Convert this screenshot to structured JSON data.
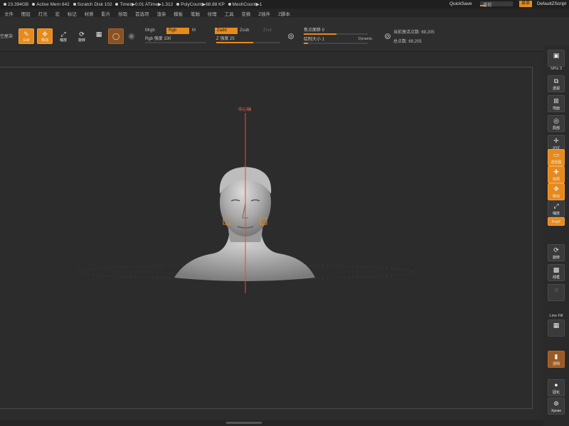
{
  "status_bar": {
    "items": [
      "23.394GB",
      "Active Mem 642",
      "Scratch Disk 102",
      "Timer▶0.01 ATime▶1.312",
      "PolyCount▶68.88 KP",
      "MeshCount▶1"
    ],
    "quicksave": "QuickSave",
    "transparency": "透视",
    "menus_button": "菜单",
    "zscript": "DefaultZScript"
  },
  "menu_bar": {
    "items": [
      "文件",
      "图层",
      "灯光",
      "宏",
      "标记",
      "材质",
      "影片",
      "拾取",
      "首选项",
      "渲染",
      "模板",
      "笔触",
      "纹理",
      "工具",
      "变换",
      "Z插件",
      "Z脚本"
    ]
  },
  "shelf": {
    "left_label": "空屋染",
    "buttons": [
      {
        "icon": "edit-icon",
        "label": "Edit",
        "active": true
      },
      {
        "icon": "move-icon",
        "label": "移动",
        "active": true
      },
      {
        "icon": "scale-icon",
        "label": "缩放",
        "active": false
      },
      {
        "icon": "rotate-icon",
        "label": "旋转",
        "active": false
      },
      {
        "icon": "sphere-icon",
        "label": "",
        "active": true
      }
    ],
    "mrgb": "Mrgb",
    "rgb": "Rgb",
    "m": "M",
    "rgb_intensity": "Rgb 强度 100",
    "zadd": "Zadd",
    "zsub": "Zsub",
    "zcut": "Zcut",
    "z_intensity": "Z 强度 25",
    "focal_shift": "焦点面移 0",
    "draw_size": "绘制大小 1",
    "dynamic": "Dynamic",
    "active_points": "当前激活点数: 69,205",
    "total_points": "总点数: 69,205"
  },
  "viewport": {
    "axis_label": "中心轴"
  },
  "right_panel": {
    "spix": "SPix 3",
    "buttons": [
      {
        "label": "透视",
        "icon": "perspective-icon",
        "style": "normal"
      },
      {
        "label": "地面",
        "icon": "floor-icon",
        "style": "normal"
      },
      {
        "label": "局部",
        "icon": "local-icon",
        "style": "normal"
      },
      {
        "label": "XYZ",
        "icon": "xyz-axis-icon",
        "style": "normal"
      },
      {
        "label": "透视图",
        "icon": "frame-icon",
        "style": "orange"
      },
      {
        "label": "快照",
        "icon": "snapshot-icon",
        "style": "orange"
      },
      {
        "label": "移动",
        "icon": "move-icon",
        "style": "orange"
      },
      {
        "label": "缩放",
        "icon": "scale-icon",
        "style": "normal"
      },
      {
        "label": "旋转",
        "icon": "rotate-icon",
        "style": "normal"
      },
      {
        "label": "线框",
        "icon": "polyframe-icon",
        "style": "normal"
      },
      {
        "label": "透明",
        "icon": "transparent-icon",
        "style": "brown"
      },
      {
        "label": "固化",
        "icon": "solo-icon",
        "style": "normal"
      },
      {
        "label": "Xpose",
        "icon": "xpose-icon",
        "style": "normal"
      }
    ],
    "line_fill": "Line Fill",
    "tool_text": "PolyF"
  },
  "colors": {
    "accent": "#e88a1a",
    "axis": "#ff3b3b",
    "background": "#2c2c2c"
  }
}
